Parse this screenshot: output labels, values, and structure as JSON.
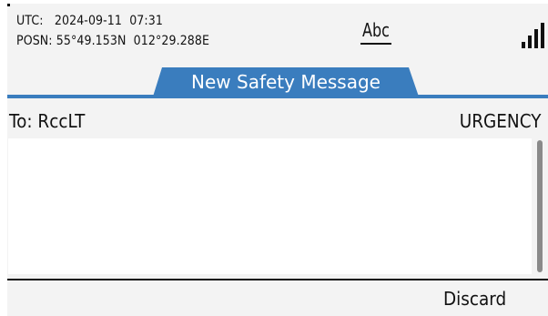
{
  "status": {
    "utc_label": "UTC:",
    "utc_value": "2024-09-11  07:31",
    "posn_label": "POSN:",
    "posn_value": "55°49.153N  012°29.288E",
    "input_mode": "Abc",
    "signal_icon": "signal-strength-icon"
  },
  "tab": {
    "title": "New Safety Message"
  },
  "colors": {
    "accent": "#3a7dbe",
    "screen_bg": "#f3f3f3",
    "text": "#111111"
  },
  "message": {
    "to_label": "To:",
    "to_value": "RccLT",
    "priority": "URGENCY",
    "body": ""
  },
  "softkeys": {
    "discard_label": "Discard"
  }
}
